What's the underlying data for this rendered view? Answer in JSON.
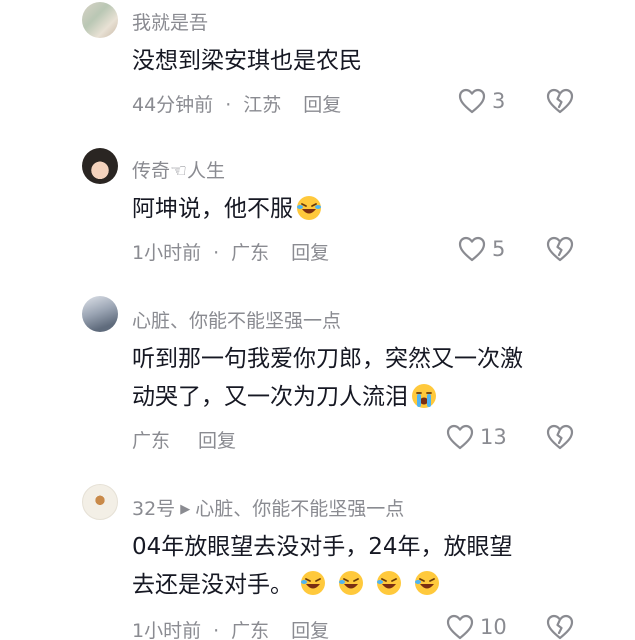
{
  "comments": [
    {
      "nickname": "我就是吾",
      "reply_to": null,
      "text": "没想到梁安琪也是农民",
      "emojis": 0,
      "time": "44分钟前",
      "location": "江苏",
      "reply_label": "回复",
      "likes": "3"
    },
    {
      "nickname": "传奇☜人生",
      "reply_to": null,
      "text": "阿坤说，他不服",
      "emojis": 1,
      "time": "1小时前",
      "location": "广东",
      "reply_label": "回复",
      "likes": "5"
    },
    {
      "nickname": "心脏、你能不能坚强一点",
      "reply_to": null,
      "text_line1": "听到那一句我爱你刀郎，突然又一次激",
      "text_line2": "动哭了，又一次为刀人流泪",
      "time": "",
      "location": "广东",
      "reply_label": "回复",
      "likes": "13"
    },
    {
      "nickname": "32号",
      "reply_to": "心脏、你能不能坚强一点",
      "text_line1": "04年放眼望去没对手，24年，放眼望",
      "text_line2": "去还是没对手。",
      "time": "1小时前",
      "location": "广东",
      "reply_label": "回复",
      "likes": "10"
    }
  ],
  "colors": {
    "text": "#161823",
    "secondary": "#8a8b91",
    "emoji_yellow": "#ffc93c"
  }
}
